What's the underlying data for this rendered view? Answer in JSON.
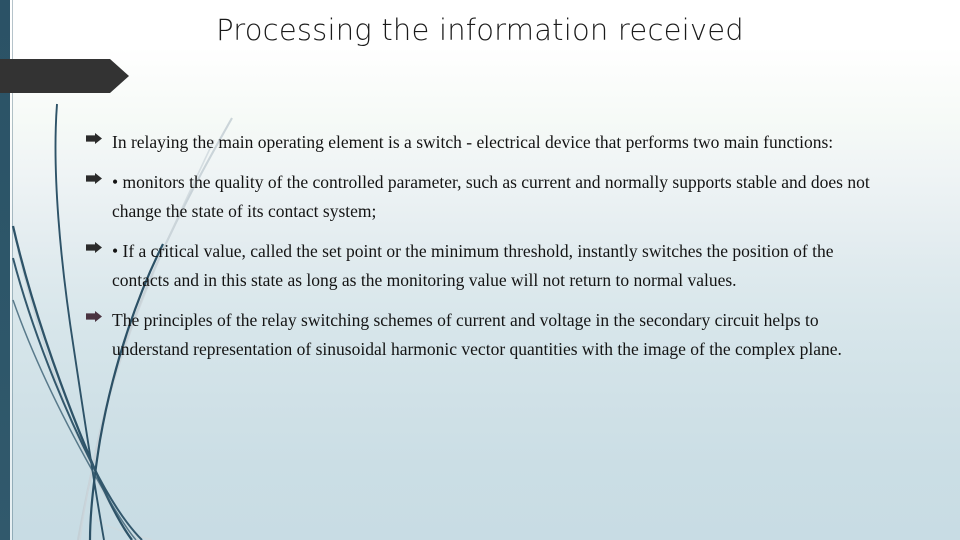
{
  "slide": {
    "title": "Processing the information received",
    "bullets": [
      {
        "marker": "arrow-bullet-icon",
        "text": "In relaying the main operating element is a switch - electrical device that performs two main functions:"
      },
      {
        "marker": "arrow-bullet-icon",
        "text": "• monitors the quality of the controlled parameter, such as current and normally supports stable and does not change the state of its contact system;"
      },
      {
        "marker": "arrow-bullet-icon",
        "text": "• If a critical value, called the set point or the minimum threshold, instantly switches the position of the contacts and in this state as long as the monitoring value will not return to normal values."
      },
      {
        "marker": "arrow-bullet-icon",
        "text": "The principles of the relay switching schemes of current and voltage in the secondary circuit helps to understand representation of sinusoidal harmonic vector quantities with the image of the complex plane."
      }
    ],
    "decor": {
      "left_bar": "left-accent-bar",
      "arrow_banner": "arrow-banner-shape",
      "grass_lines": "grass-blade-decoration"
    },
    "colors": {
      "accent_bar": "#2b5266",
      "arrow_banner": "#333333",
      "blade_dark": "#2e5368",
      "blade_light": "#b9c6cc",
      "title_text": "#1a1a1a",
      "body_text": "#141414",
      "background_top": "#ffffff",
      "background_bottom": "#c8dce4"
    }
  }
}
